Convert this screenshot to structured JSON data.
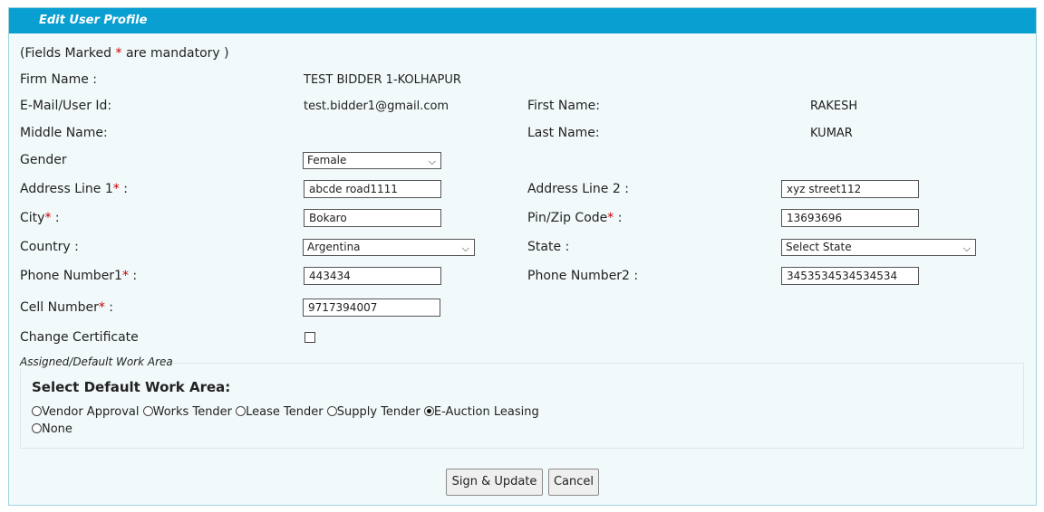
{
  "panel": {
    "title": "Edit User Profile",
    "mandatory_note_prefix": "(Fields Marked ",
    "mandatory_note_star": "*",
    "mandatory_note_suffix": " are mandatory )"
  },
  "fields": {
    "firm_name": {
      "label": "Firm Name :",
      "value": "TEST BIDDER 1-KOLHAPUR"
    },
    "email": {
      "label": "E-Mail/User Id:",
      "value": "test.bidder1@gmail.com"
    },
    "first_name": {
      "label": "First Name:",
      "value": "RAKESH"
    },
    "middle_name": {
      "label": "Middle Name:",
      "value": ""
    },
    "last_name": {
      "label": "Last Name:",
      "value": "KUMAR"
    },
    "gender": {
      "label": "Gender",
      "value": "Female"
    },
    "address1": {
      "label": "Address Line 1",
      "suffix": " :",
      "value": "abcde road1111"
    },
    "address2": {
      "label": "Address Line 2 :",
      "value": "xyz street112"
    },
    "city": {
      "label": "City",
      "suffix": " :",
      "value": "Bokaro"
    },
    "pin": {
      "label": "Pin/Zip Code",
      "suffix": " :",
      "value": "13693696"
    },
    "country": {
      "label": "Country :",
      "value": "Argentina"
    },
    "state": {
      "label": "State :",
      "value": "Select State"
    },
    "phone1": {
      "label": "Phone Number1",
      "suffix": " :",
      "value": "443434"
    },
    "phone2": {
      "label": "Phone Number2 :",
      "value": "3453534534534534"
    },
    "cell": {
      "label": "Cell Number",
      "suffix": " :",
      "value": "9717394007"
    },
    "change_cert": {
      "label": "Change Certificate"
    }
  },
  "required_star": "*",
  "work_area": {
    "legend": "Assigned/Default Work Area",
    "heading": "Select Default Work Area:",
    "options": [
      "Vendor Approval",
      "Works Tender",
      "Lease Tender",
      "Supply Tender",
      "E-Auction Leasing",
      "None"
    ],
    "selected": "E-Auction Leasing"
  },
  "buttons": {
    "update": "Sign & Update",
    "cancel": "Cancel"
  }
}
